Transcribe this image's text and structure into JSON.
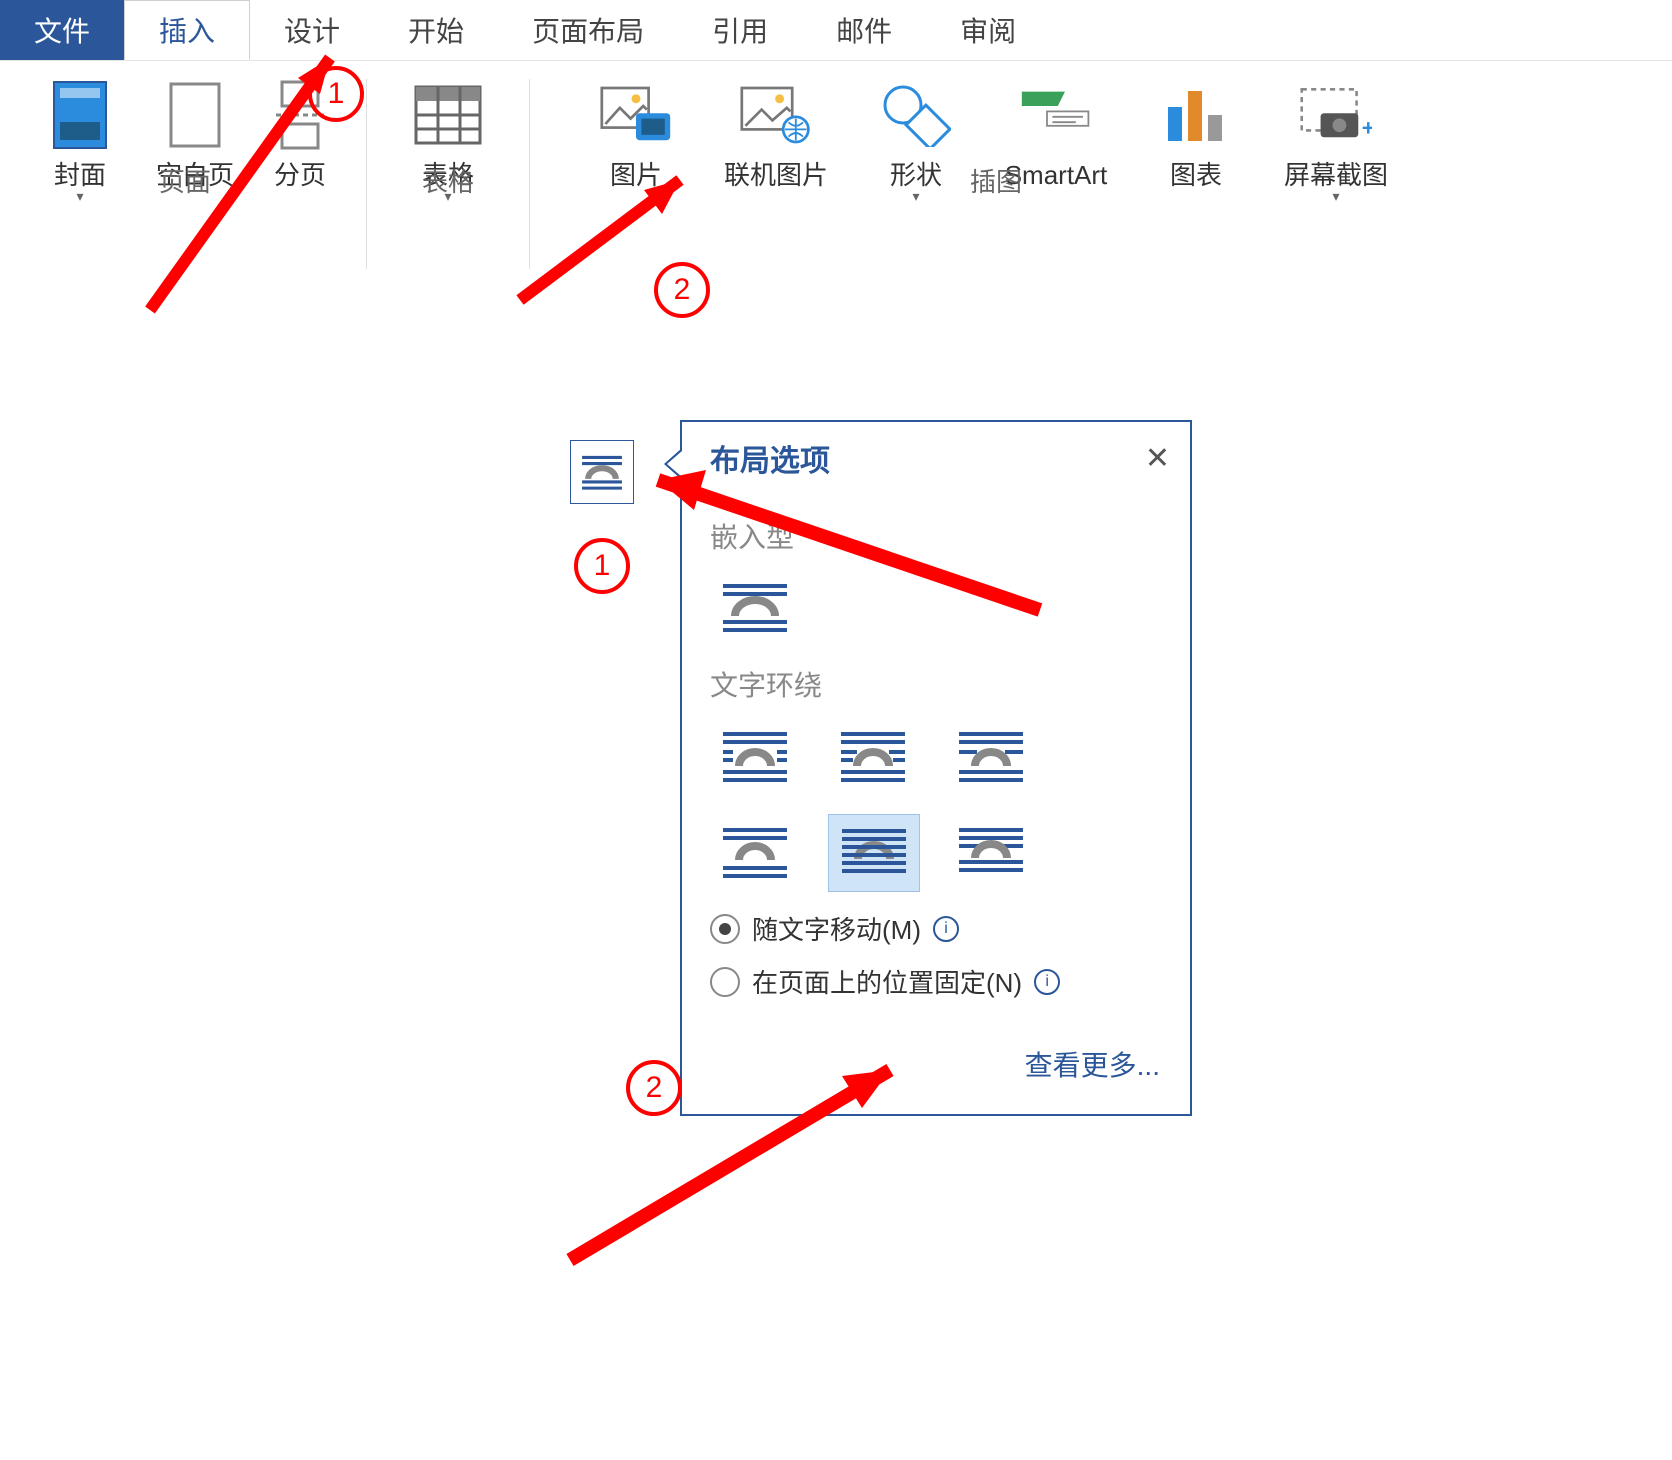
{
  "tabs": {
    "file": "文件",
    "insert": "插入",
    "design": "设计",
    "home": "开始",
    "layout": "页面布局",
    "references": "引用",
    "mailings": "邮件",
    "review": "审阅"
  },
  "groups": {
    "pages": {
      "title": "页面",
      "cover": "封面",
      "blank": "空白页",
      "break": "分页"
    },
    "tables": {
      "title": "表格",
      "table": "表格"
    },
    "illustrations": {
      "title": "插图",
      "picture": "图片",
      "online_picture": "联机图片",
      "shapes": "形状",
      "smartart": "SmartArt",
      "chart": "图表",
      "screenshot": "屏幕截图"
    }
  },
  "panel": {
    "title": "布局选项",
    "section_inline": "嵌入型",
    "section_wrap": "文字环绕",
    "radio_move": "随文字移动(M)",
    "radio_fixed": "在页面上的位置固定(N)",
    "see_more": "查看更多..."
  },
  "annotations": {
    "n1": "1",
    "n2": "2"
  }
}
